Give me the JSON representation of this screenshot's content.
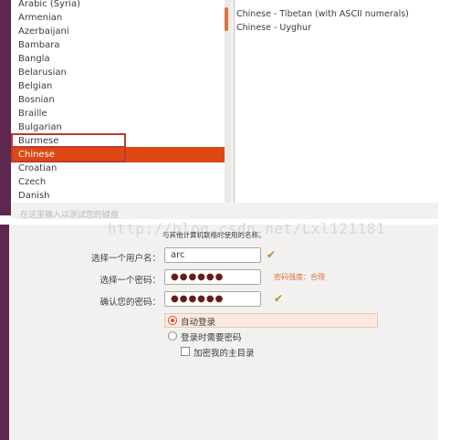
{
  "language_list": {
    "items": [
      "Arabic (Syria)",
      "Armenian",
      "Azerbaijani",
      "Bambara",
      "Bangla",
      "Belarusian",
      "Belgian",
      "Bosnian",
      "Braille",
      "Bulgarian",
      "Burmese",
      "Chinese",
      "Croatian",
      "Czech",
      "Danish"
    ],
    "selected": "Chinese",
    "highlighted": "Burmese"
  },
  "variant_list": {
    "items": [
      "Chinese - Tibetan (with ASCII numerals)",
      "Chinese - Uyghur"
    ]
  },
  "hint_partial": "在这里输入以测试您的键盘",
  "watermark": "http://blog.csdn.net/Lxl121181",
  "form": {
    "hint": "与其他计算机联络时使用的名称。",
    "username_label": "选择一个用户名：",
    "username_value": "arc",
    "password_label": "选择一个密码：",
    "password_value": "●●●●●●",
    "password_strength": "密码强度：合理",
    "confirm_label": "确认您的密码：",
    "confirm_value": "●●●●●●",
    "options": {
      "auto_login": "自动登录",
      "require_password": "登录时需要密码",
      "encrypt_home": "加密我的主目录"
    },
    "check_mark": "✔"
  },
  "colors": {
    "accent": "#dd4814",
    "aubergine": "#5e2750",
    "check": "#b88a3a"
  }
}
